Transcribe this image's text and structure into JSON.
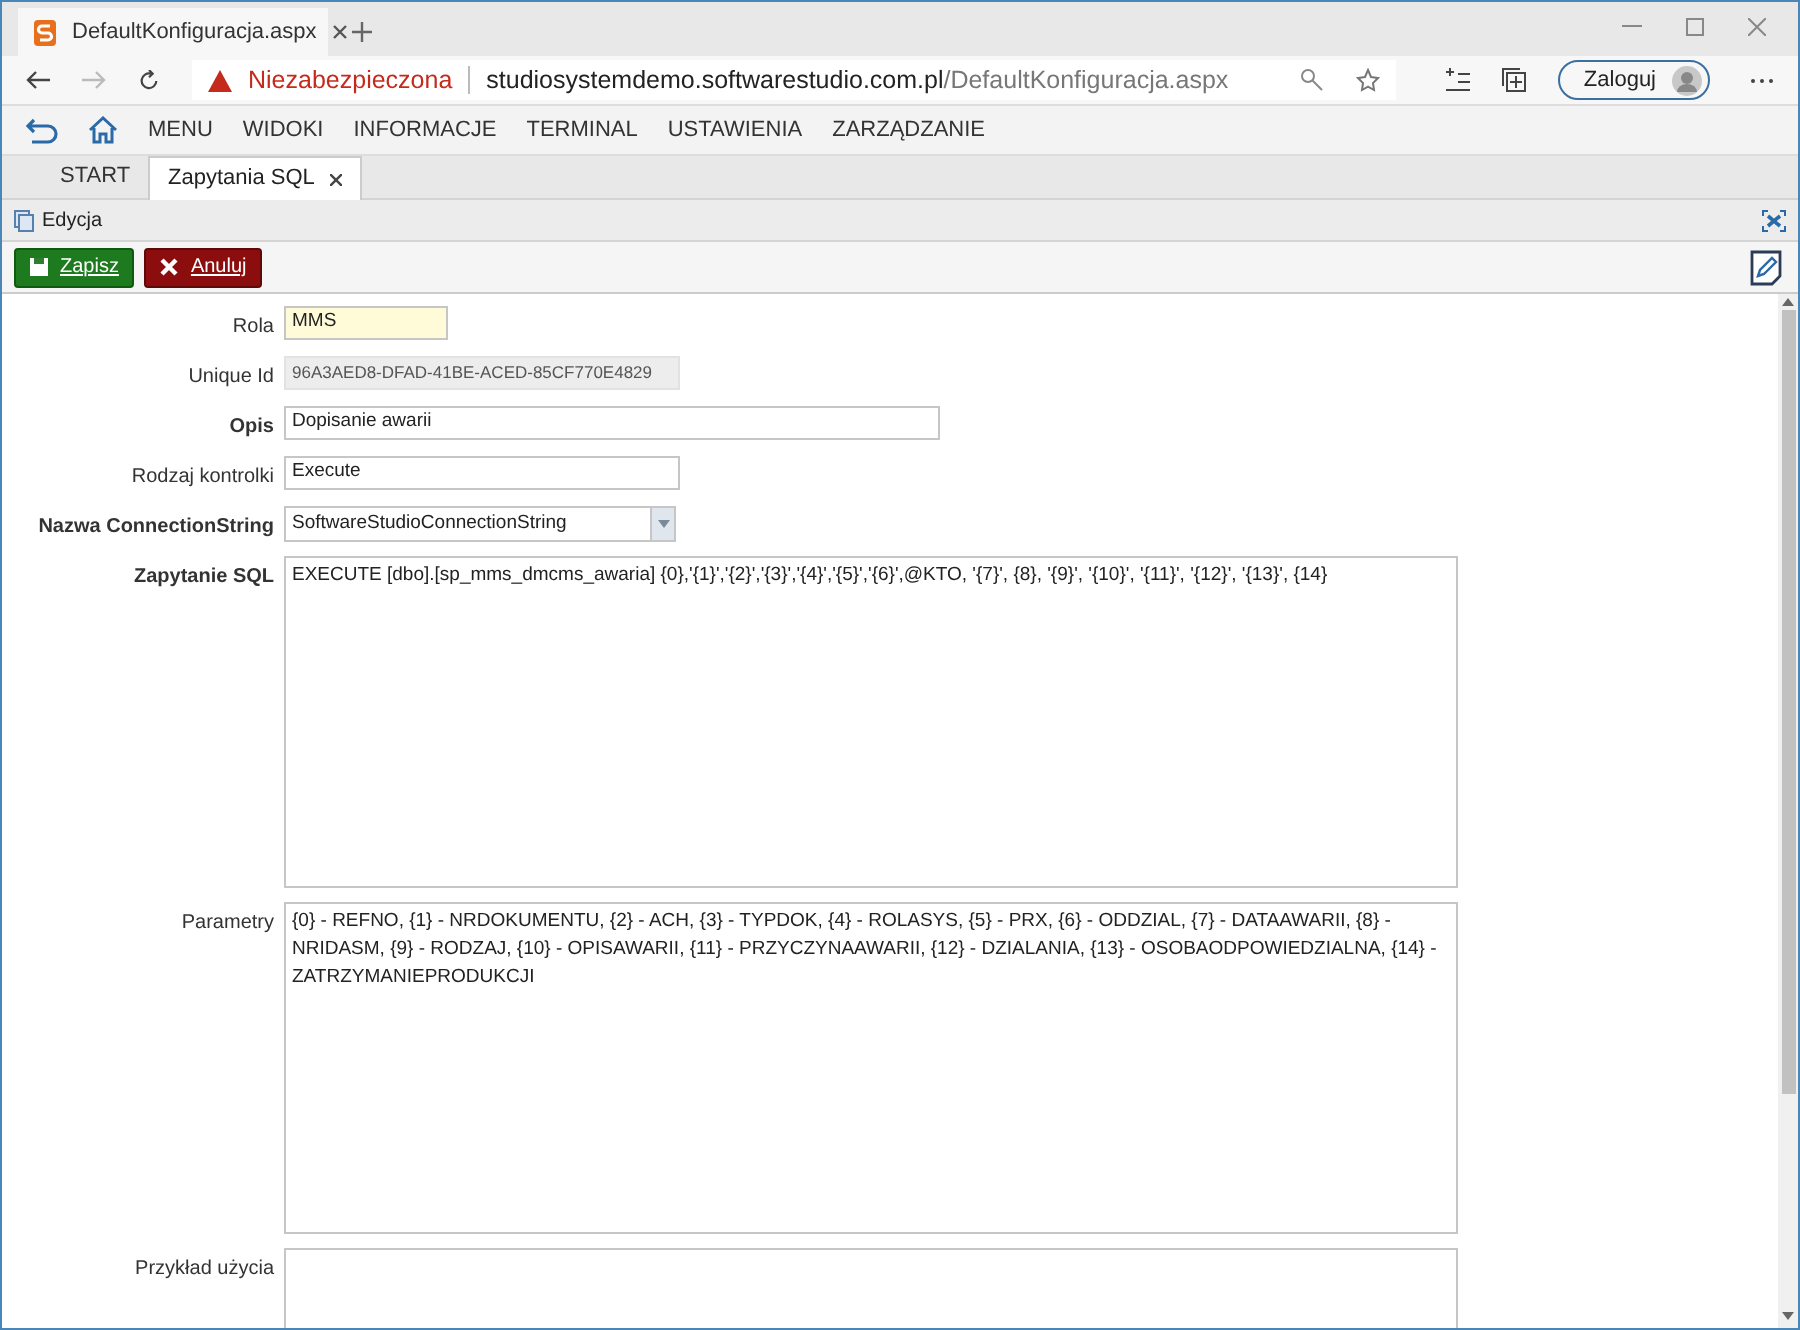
{
  "browser": {
    "tab_title": "DefaultKonfiguracja.aspx",
    "security_label": "Niezabezpieczona",
    "url_host": "studiosystemdemo.softwarestudio.com.pl",
    "url_path": "/DefaultKonfiguracja.aspx",
    "signin_label": "Zaloguj"
  },
  "menu": [
    "MENU",
    "WIDOKI",
    "INFORMACJE",
    "TERMINAL",
    "USTAWIENIA",
    "ZARZĄDZANIE"
  ],
  "tabs": [
    {
      "label": "START",
      "selected": false,
      "closable": false
    },
    {
      "label": "Zapytania SQL",
      "selected": true,
      "closable": true
    }
  ],
  "panel_title": "Edycja",
  "buttons": [
    {
      "kind": "save",
      "label": "Zapisz"
    },
    {
      "kind": "cancel",
      "label": "Anuluj"
    }
  ],
  "fields": [
    {
      "label": "Rola",
      "bold": false,
      "kind": "text",
      "value": "MMS",
      "focused": true
    },
    {
      "label": "Unique Id",
      "bold": false,
      "kind": "readonly",
      "value": "96A3AED8-DFAD-41BE-ACED-85CF770E4829",
      "focused": false
    },
    {
      "label": "Opis",
      "bold": true,
      "kind": "text",
      "value": "Dopisanie awarii",
      "focused": false
    },
    {
      "label": "Rodzaj kontrolki",
      "bold": false,
      "kind": "text",
      "value": "Execute",
      "focused": false
    },
    {
      "label": "Nazwa ConnectionString",
      "bold": true,
      "kind": "select",
      "value": "SoftwareStudioConnectionString",
      "focused": false
    },
    {
      "label": "Zapytanie SQL",
      "bold": true,
      "kind": "textarea",
      "value": "EXECUTE [dbo].[sp_mms_dmcms_awaria] {0},'{1}','{2}','{3}','{4}','{5}','{6}',@KTO, '{7}', {8}, '{9}', '{10}', '{11}', '{12}', '{13}', {14}",
      "focused": false
    },
    {
      "label": "Parametry",
      "bold": false,
      "kind": "textarea",
      "value": "{0} - REFNO, {1} - NRDOKUMENTU, {2} - ACH, {3} - TYPDOK, {4} - ROLASYS, {5} - PRX, {6} - ODDZIAL, {7} - DATAAWARII, {8} - NRIDASM, {9} - RODZAJ, {10} - OPISAWARII, {11} - PRZYCZYNAAWARII, {12} - DZIALANIA, {13} - OSOBAODPOWIEDZIALNA, {14} - ZATRZYMANIEPRODUKCJI",
      "focused": false
    },
    {
      "label": "Przykład użycia",
      "bold": false,
      "kind": "textarea",
      "focused": false
    }
  ]
}
